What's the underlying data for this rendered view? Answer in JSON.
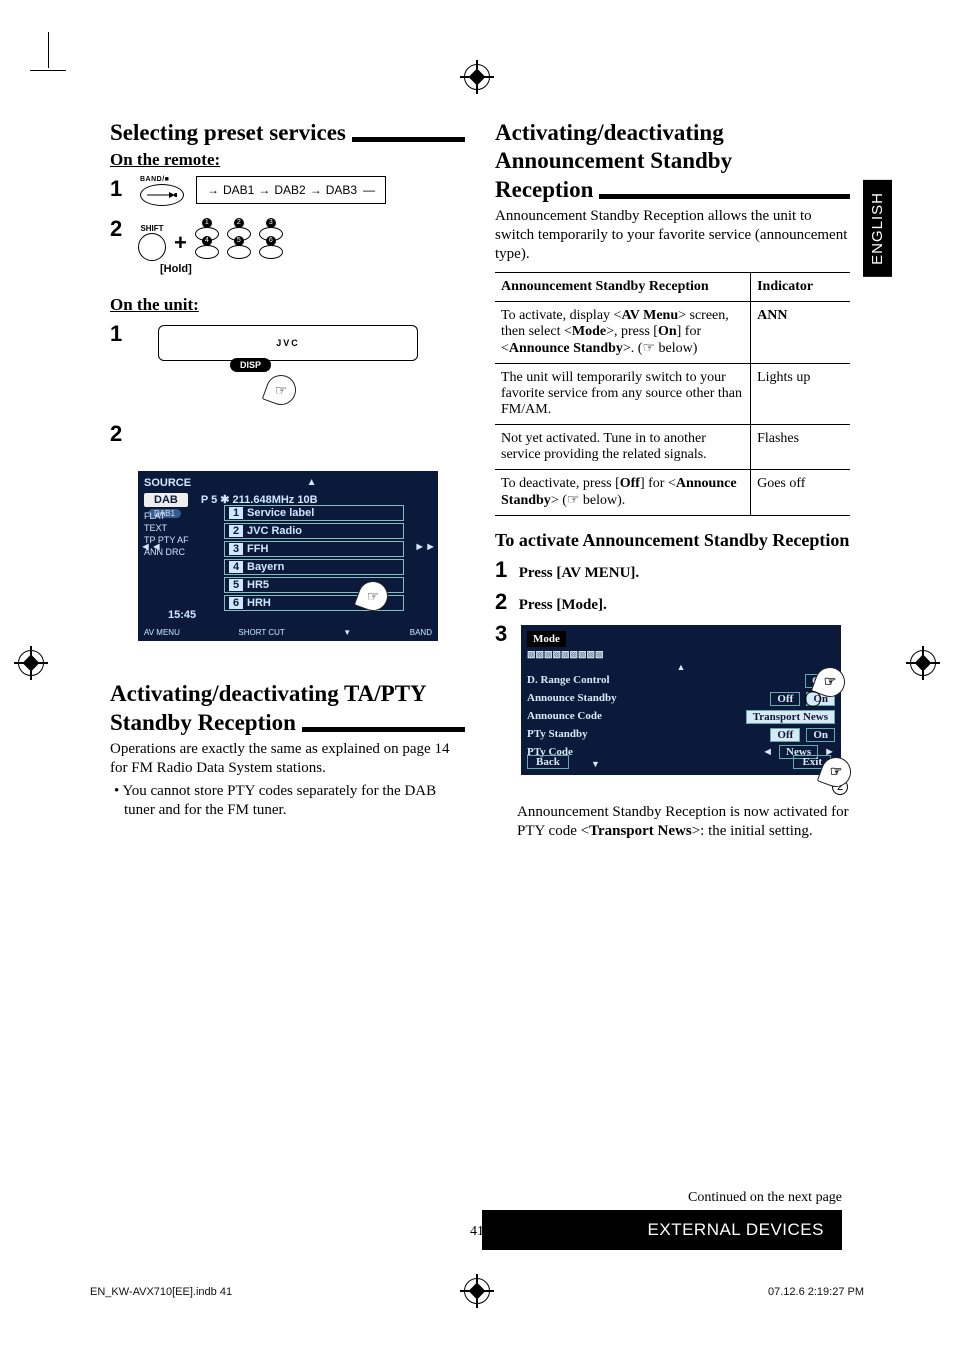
{
  "language_tab": "ENGLISH",
  "left": {
    "title1": "Selecting preset services",
    "remote_label": "On the remote:",
    "dab_seq": [
      "DAB1",
      "DAB2",
      "DAB3"
    ],
    "band_label": "BAND/■",
    "shift_label": "SHIFT",
    "hold_label": "[Hold]",
    "unit_label": "On the unit:",
    "jvc": "JVC",
    "disp": "DISP",
    "lcd": {
      "source": "SOURCE",
      "dab": "DAB",
      "sub": "DAB1",
      "freq": "P 5   ✱   211.648MHz      10B",
      "items": [
        "Service label",
        "JVC Radio",
        "FFH",
        "Bayern",
        "HR5",
        "HRH"
      ],
      "left_flags": [
        "FLAT",
        "TEXT",
        "TP PTY AF",
        "ANN  DRC"
      ],
      "time": "15:45",
      "b_left": "AV MENU",
      "b_mid": "SHORT CUT",
      "b_right": "BAND"
    },
    "title2_a": "Activating/deactivating TA/PTY",
    "title2_b": "Standby Reception",
    "para2": "Operations are exactly the same as explained on page 14 for FM Radio Data System stations.",
    "bullet2": "•  You cannot store PTY codes separately for the DAB tuner and for the FM tuner."
  },
  "right": {
    "title_a": "Activating/deactivating",
    "title_b": "Announcement Standby",
    "title_c": "Reception",
    "intro": "Announcement Standby Reception allows the unit to switch temporarily to your favorite service (announcement type).",
    "th1": "Announcement Standby Reception",
    "th2": "Indicator",
    "rows": [
      {
        "l": "To activate, display <AV Menu> screen, then select <Mode>, press [On] for <Announce Standby>. (☞ below)",
        "r": "ANN"
      },
      {
        "l": "The unit will temporarily switch to your favorite service from any source other than FM/AM.",
        "r": "Lights up"
      },
      {
        "l": "Not yet activated. Tune in to another service providing the related signals.",
        "r": "Flashes"
      },
      {
        "l": "To deactivate, press [Off] for <Announce Standby> (☞ below).",
        "r": "Goes off"
      }
    ],
    "subhead": "To activate Announcement Standby Reception",
    "step1": "Press [AV MENU].",
    "step2": "Press [Mode].",
    "mode": {
      "title": "Mode",
      "rows": [
        {
          "k": "D. Range Control",
          "v": "Off"
        },
        {
          "k": "Announce Standby",
          "off": "Off",
          "on": "On",
          "sel": "on"
        },
        {
          "k": "Announce Code",
          "v": "Transport News"
        },
        {
          "k": "PTy Standby",
          "off": "Off",
          "on": "On",
          "sel": "off"
        },
        {
          "k": "PTy Code",
          "v": "News"
        }
      ],
      "back": "Back",
      "exit": "Exit"
    },
    "after_a": "Announcement Standby Reception is now activated for PTY code <",
    "after_b": "Transport News",
    "after_c": ">: the initial setting."
  },
  "footer": {
    "continued": "Continued on the next page",
    "section": "EXTERNAL DEVICES",
    "page": "41",
    "print_l": "EN_KW-AVX710[EE].indb   41",
    "print_r": "07.12.6   2:19:27 PM"
  }
}
